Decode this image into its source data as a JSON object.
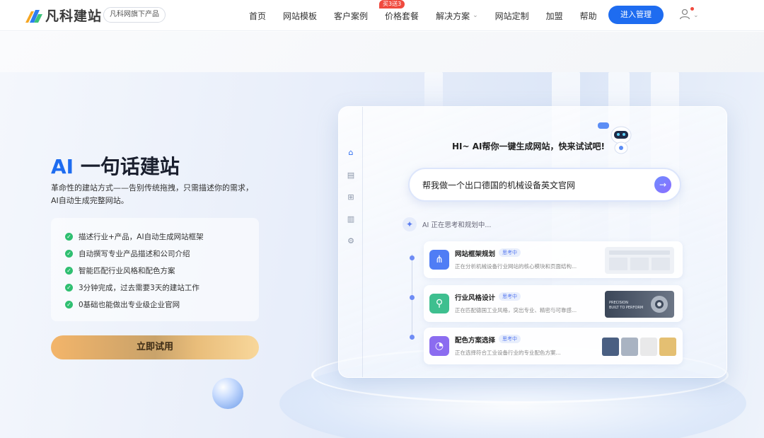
{
  "header": {
    "logo_text": "凡科建站",
    "logo_tag": "凡科网旗下产品",
    "nav": [
      {
        "label": "首页"
      },
      {
        "label": "网站模板"
      },
      {
        "label": "客户案例"
      },
      {
        "label": "价格套餐",
        "badge": "买3送3"
      },
      {
        "label": "解决方案",
        "dropdown": true
      },
      {
        "label": "网站定制"
      },
      {
        "label": "加盟"
      },
      {
        "label": "帮助"
      }
    ],
    "login_button": "进入管理"
  },
  "hero": {
    "title_ai": "AI",
    "title_rest": " 一句话建站",
    "desc_line1": "革命性的建站方式——告别传统拖拽，只需描述你的需求，",
    "desc_line2": "AI自动生成完整网站。",
    "features": [
      "描述行业+产品，AI自动生成网站框架",
      "自动撰写专业产品描述和公司介绍",
      "智能匹配行业风格和配色方案",
      "3分钟完成，过去需要3天的建站工作",
      "0基础也能做出专业级企业官网"
    ],
    "try_button": "立即试用"
  },
  "demo": {
    "greeting": "HI~ AI帮你一键生成网站，快来试试吧!",
    "prompt_text": "帮我做一个出口德国的机械设备英文官网",
    "thinking": "AI 正在思考和规划中...",
    "steps": [
      {
        "title": "网站框架规划",
        "tag": "思考中",
        "sub": "正在分析机械设备行业网站的核心模块和页面结构...",
        "color": "#4f7df5",
        "icon": "framework-icon"
      },
      {
        "title": "行业风格设计",
        "tag": "思考中",
        "sub": "正在匹配德国工业风格，突出专业、精密与可靠感...",
        "color": "#3ebf8f",
        "icon": "style-icon"
      },
      {
        "title": "配色方案选择",
        "tag": "思考中",
        "sub": "正在选择符合工业设备行业的专业配色方案...",
        "color": "#8b6cf0",
        "icon": "palette-icon"
      }
    ],
    "thumb_text_1": "PRECISION",
    "thumb_text_2": "BUILT TO PERFORM",
    "swatches": [
      "#4a5f82",
      "#a9b3c2",
      "#e9e9ea",
      "#e4bf72"
    ]
  }
}
